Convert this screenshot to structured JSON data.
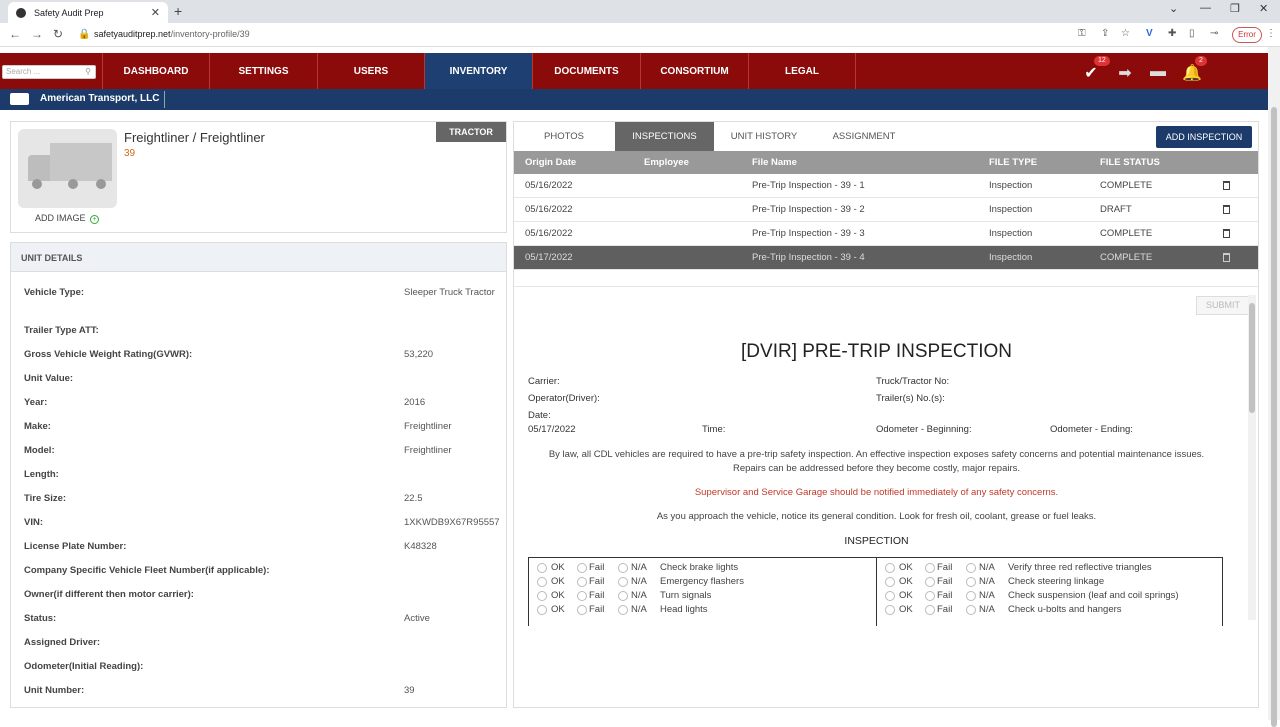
{
  "browser": {
    "tab_title": "Safety Audit Prep",
    "url_host": "safetyauditprep.net",
    "url_path": "/inventory-profile/39",
    "error_label": "Error"
  },
  "nav": {
    "search_placeholder": "Search ...",
    "items": [
      "DASHBOARD",
      "SETTINGS",
      "USERS",
      "INVENTORY",
      "DOCUMENTS",
      "CONSORTIUM",
      "LEGAL"
    ],
    "active": "INVENTORY",
    "check_badge": "12",
    "bell_badge": "2"
  },
  "company": {
    "name": "American Transport, LLC"
  },
  "unit": {
    "title": "Freightliner / Freightliner",
    "number": "39",
    "type_badge": "TRACTOR",
    "add_image": "ADD IMAGE"
  },
  "unit_details": {
    "heading": "UNIT DETAILS",
    "rows": [
      {
        "label": "Vehicle Type:",
        "value": "Sleeper Truck Tractor"
      },
      {
        "label": "Trailer Type ATT:",
        "value": ""
      },
      {
        "label": "Gross Vehicle Weight Rating(GVWR):",
        "value": "53,220"
      },
      {
        "label": "Unit Value:",
        "value": ""
      },
      {
        "label": "Year:",
        "value": "2016"
      },
      {
        "label": "Make:",
        "value": "Freightliner"
      },
      {
        "label": "Model:",
        "value": "Freightliner"
      },
      {
        "label": "Length:",
        "value": ""
      },
      {
        "label": "Tire Size:",
        "value": "22.5"
      },
      {
        "label": "VIN:",
        "value": "1XKWDB9X67R95557"
      },
      {
        "label": "License Plate Number:",
        "value": "K48328"
      },
      {
        "label": "Company Specific Vehicle Fleet Number(if applicable):",
        "value": ""
      },
      {
        "label": "Owner(if different then motor carrier):",
        "value": ""
      },
      {
        "label": "Status:",
        "value": "Active"
      },
      {
        "label": "Assigned Driver:",
        "value": ""
      },
      {
        "label": "Odometer(Initial Reading):",
        "value": ""
      },
      {
        "label": "Unit Number:",
        "value": "39"
      }
    ]
  },
  "tabs": {
    "items": [
      "PHOTOS",
      "INSPECTIONS",
      "UNIT HISTORY",
      "ASSIGNMENT"
    ],
    "active": "INSPECTIONS",
    "add_button": "ADD INSPECTION"
  },
  "table": {
    "columns": [
      "Origin Date",
      "Employee",
      "File Name",
      "FILE TYPE",
      "FILE STATUS"
    ],
    "rows": [
      {
        "date": "05/16/2022",
        "employee": "",
        "file": "Pre-Trip Inspection - 39 - 1",
        "type": "Inspection",
        "status": "COMPLETE"
      },
      {
        "date": "05/16/2022",
        "employee": "",
        "file": "Pre-Trip Inspection - 39 - 2",
        "type": "Inspection",
        "status": "DRAFT"
      },
      {
        "date": "05/16/2022",
        "employee": "",
        "file": "Pre-Trip Inspection - 39 - 3",
        "type": "Inspection",
        "status": "COMPLETE"
      },
      {
        "date": "05/17/2022",
        "employee": "",
        "file": "Pre-Trip Inspection - 39 - 4",
        "type": "Inspection",
        "status": "COMPLETE"
      }
    ]
  },
  "form": {
    "submit": "SUBMIT",
    "title": "[DVIR] PRE-TRIP INSPECTION",
    "carrier": "Carrier:",
    "truck_no": "Truck/Tractor No:",
    "operator": "Operator(Driver):",
    "trailer_no": "Trailer(s) No.(s):",
    "date_label": "Date:",
    "date_value": "05/17/2022",
    "time": "Time:",
    "odo_begin": "Odometer - Beginning:",
    "odo_end": "Odometer - Ending:",
    "para1": "By law, all CDL vehicles are required to have a pre-trip safety inspection. An effective inspection exposes safety concerns and potential maintenance issues. Repairs can be addressed before they become costly, major repairs.",
    "para2": "Supervisor and Service Garage should be notified immediately of any safety concerns.",
    "para3": "As you approach the vehicle, notice its general condition. Look for fresh oil, coolant, grease or fuel leaks.",
    "inspection_heading": "INSPECTION",
    "options": [
      "OK",
      "Fail",
      "N/A"
    ],
    "left_items": [
      "Check brake lights",
      "Emergency flashers",
      "Turn signals",
      "Head lights"
    ],
    "right_items": [
      "Verify three red reflective triangles",
      "Check steering linkage",
      "Check suspension (leaf and coil springs)",
      "Check u-bolts and hangers"
    ]
  }
}
